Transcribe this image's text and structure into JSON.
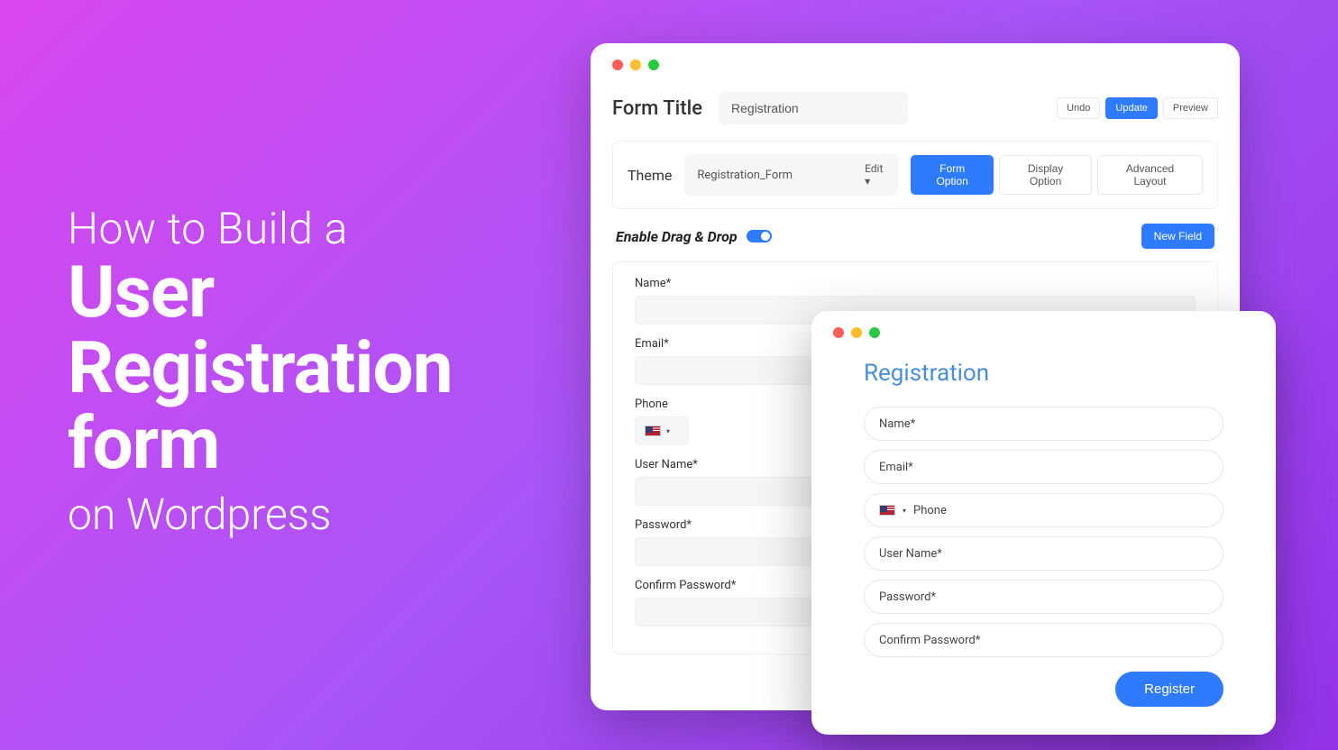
{
  "headline": {
    "line1": "How to Build a",
    "line2": "User Registration form",
    "line3": "on Wordpress"
  },
  "builder": {
    "form_title_label": "Form Title",
    "form_title_value": "Registration",
    "actions": {
      "undo": "Undo",
      "update": "Update",
      "preview": "Preview"
    },
    "theme_label": "Theme",
    "theme_value": "Registration_Form",
    "theme_edit": "Edit",
    "tabs": {
      "form_option": "Form Option",
      "display_option": "Display Option",
      "advanced_layout": "Advanced Layout"
    },
    "drag_drop_label": "Enable Drag & Drop",
    "new_field": "New Field",
    "fields": [
      {
        "label": "Name*"
      },
      {
        "label": "Email*"
      },
      {
        "label": "Phone"
      },
      {
        "label": "User Name*"
      },
      {
        "label": "Password*"
      },
      {
        "label": "Confirm Password*"
      }
    ]
  },
  "preview": {
    "title": "Registration",
    "fields": [
      {
        "placeholder": "Name*"
      },
      {
        "placeholder": "Email*"
      },
      {
        "placeholder": "Phone",
        "has_flag": true
      },
      {
        "placeholder": "User Name*"
      },
      {
        "placeholder": "Password*"
      },
      {
        "placeholder": "Confirm Password*"
      }
    ],
    "submit": "Register"
  }
}
